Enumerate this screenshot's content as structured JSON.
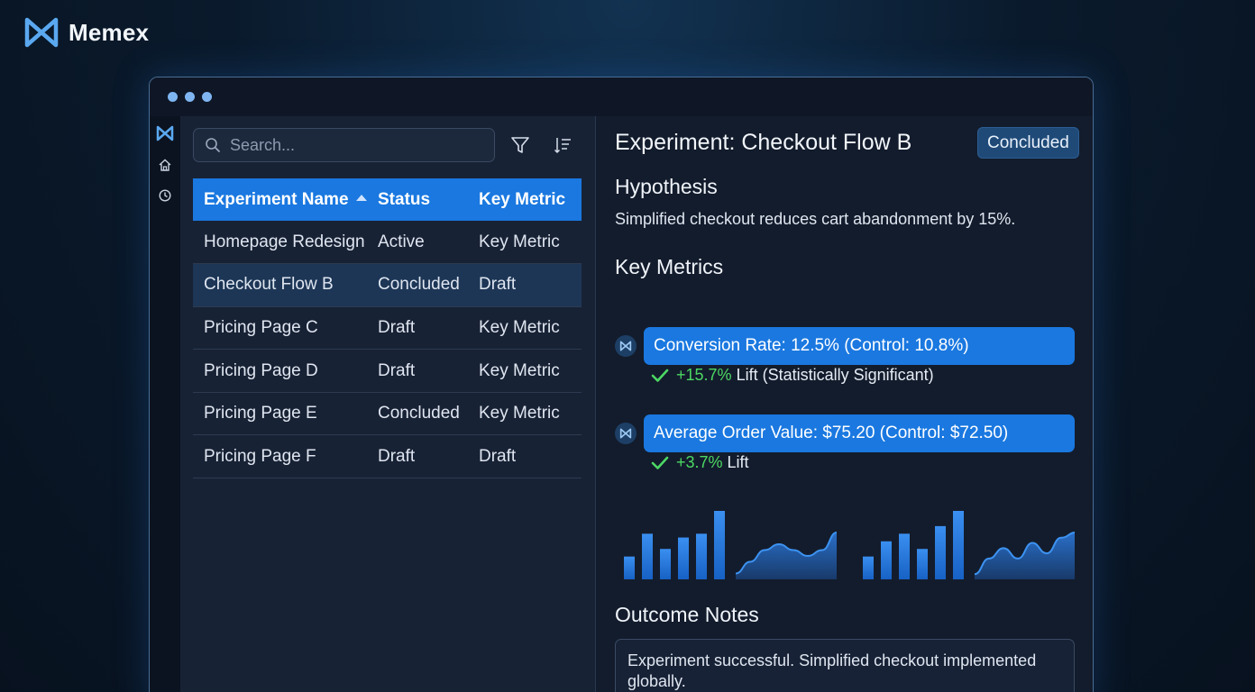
{
  "brand": {
    "name": "Memex"
  },
  "search": {
    "placeholder": "Search..."
  },
  "table": {
    "headers": [
      "Experiment Name",
      "Status",
      "Key Metric"
    ],
    "rows": [
      {
        "name": "Homepage Redesign",
        "status": "Active",
        "metric": "Key Metric"
      },
      {
        "name": "Checkout Flow B",
        "status": "Concluded",
        "metric": "Draft"
      },
      {
        "name": "Pricing Page C",
        "status": "Draft",
        "metric": "Key Metric"
      },
      {
        "name": "Pricing Page D",
        "status": "Draft",
        "metric": "Key Metric"
      },
      {
        "name": "Pricing Page E",
        "status": "Concluded",
        "metric": "Key Metric"
      },
      {
        "name": "Pricing Page F",
        "status": "Draft",
        "metric": "Draft"
      }
    ],
    "selected_row": 1
  },
  "detail": {
    "title": "Experiment: Checkout Flow B",
    "status_badge": "Concluded",
    "hypothesis_heading": "Hypothesis",
    "hypothesis_text": "Simplified checkout reduces cart abandonment by 15%.",
    "metrics_heading": "Key Metrics",
    "metrics": [
      {
        "label": "Conversion Rate: 12.5% (Control: 10.8%)",
        "lift_pct": "+15.7%",
        "lift_text": "Lift (Statistically Significant)"
      },
      {
        "label": "Average Order Value: $75.20 (Control: $72.50)",
        "lift_pct": "+3.7%",
        "lift_text": "Lift"
      }
    ],
    "notes_heading": "Outcome Notes",
    "notes_text": "Experiment successful. Simplified checkout implemented globally."
  },
  "colors": {
    "accent": "#1a78e0",
    "success": "#4cd864",
    "background": "#131c2c"
  },
  "icons": [
    "memex-logo-icon",
    "home-icon",
    "history-icon",
    "search-icon",
    "filter-icon",
    "sort-icon",
    "check-icon"
  ],
  "chart_data": [
    {
      "type": "bar",
      "values": [
        3,
        6,
        4,
        5.5,
        6,
        9
      ]
    },
    {
      "type": "area",
      "values": [
        1,
        3,
        5,
        6,
        5,
        4,
        5,
        8
      ]
    },
    {
      "type": "bar",
      "values": [
        3,
        5,
        6,
        4,
        7,
        9
      ]
    },
    {
      "type": "area",
      "values": [
        1,
        4,
        6,
        4,
        7,
        5,
        8,
        9
      ]
    }
  ]
}
